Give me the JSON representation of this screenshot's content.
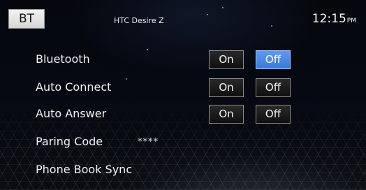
{
  "header": {
    "tab_label": "BT",
    "device_name": "HTC Desire Z",
    "time": "12:15",
    "ampm": "PM"
  },
  "settings": {
    "bluetooth": {
      "label": "Bluetooth",
      "on_label": "On",
      "off_label": "Off",
      "selected": "Off"
    },
    "auto_connect": {
      "label": "Auto Connect",
      "on_label": "On",
      "off_label": "Off"
    },
    "auto_answer": {
      "label": "Auto Answer",
      "on_label": "On",
      "off_label": "Off"
    },
    "pairing_code": {
      "label": "Paring Code",
      "value": "****"
    },
    "phone_book_sync": {
      "label": "Phone Book Sync"
    }
  },
  "colors": {
    "selected_button": "#4a86e8",
    "background": "#05070d"
  }
}
